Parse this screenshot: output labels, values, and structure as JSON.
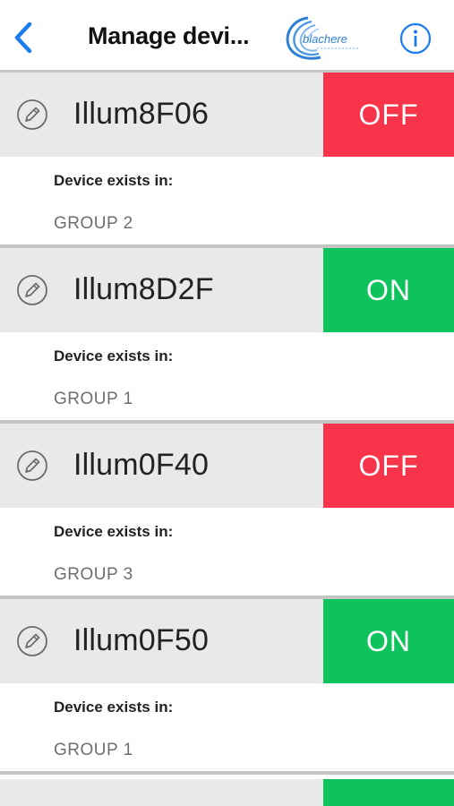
{
  "header": {
    "title": "Manage devi...",
    "logo_text": "blachere",
    "back_icon": "chevron-left-icon",
    "info_icon": "info-circle-icon"
  },
  "colors": {
    "accent_blue": "#1a7cf0",
    "off_red": "#f7344a",
    "on_green": "#0ec35b",
    "row_gray": "#e9e9e9"
  },
  "devices": [
    {
      "name": "Illum8F06",
      "state": "OFF",
      "exists_label": "Device exists in:",
      "group": "GROUP 2"
    },
    {
      "name": "Illum8D2F",
      "state": "ON",
      "exists_label": "Device exists in:",
      "group": "GROUP 1"
    },
    {
      "name": "Illum0F40",
      "state": "OFF",
      "exists_label": "Device exists in:",
      "group": "GROUP 3"
    },
    {
      "name": "Illum0F50",
      "state": "ON",
      "exists_label": "Device exists in:",
      "group": "GROUP 1"
    }
  ]
}
